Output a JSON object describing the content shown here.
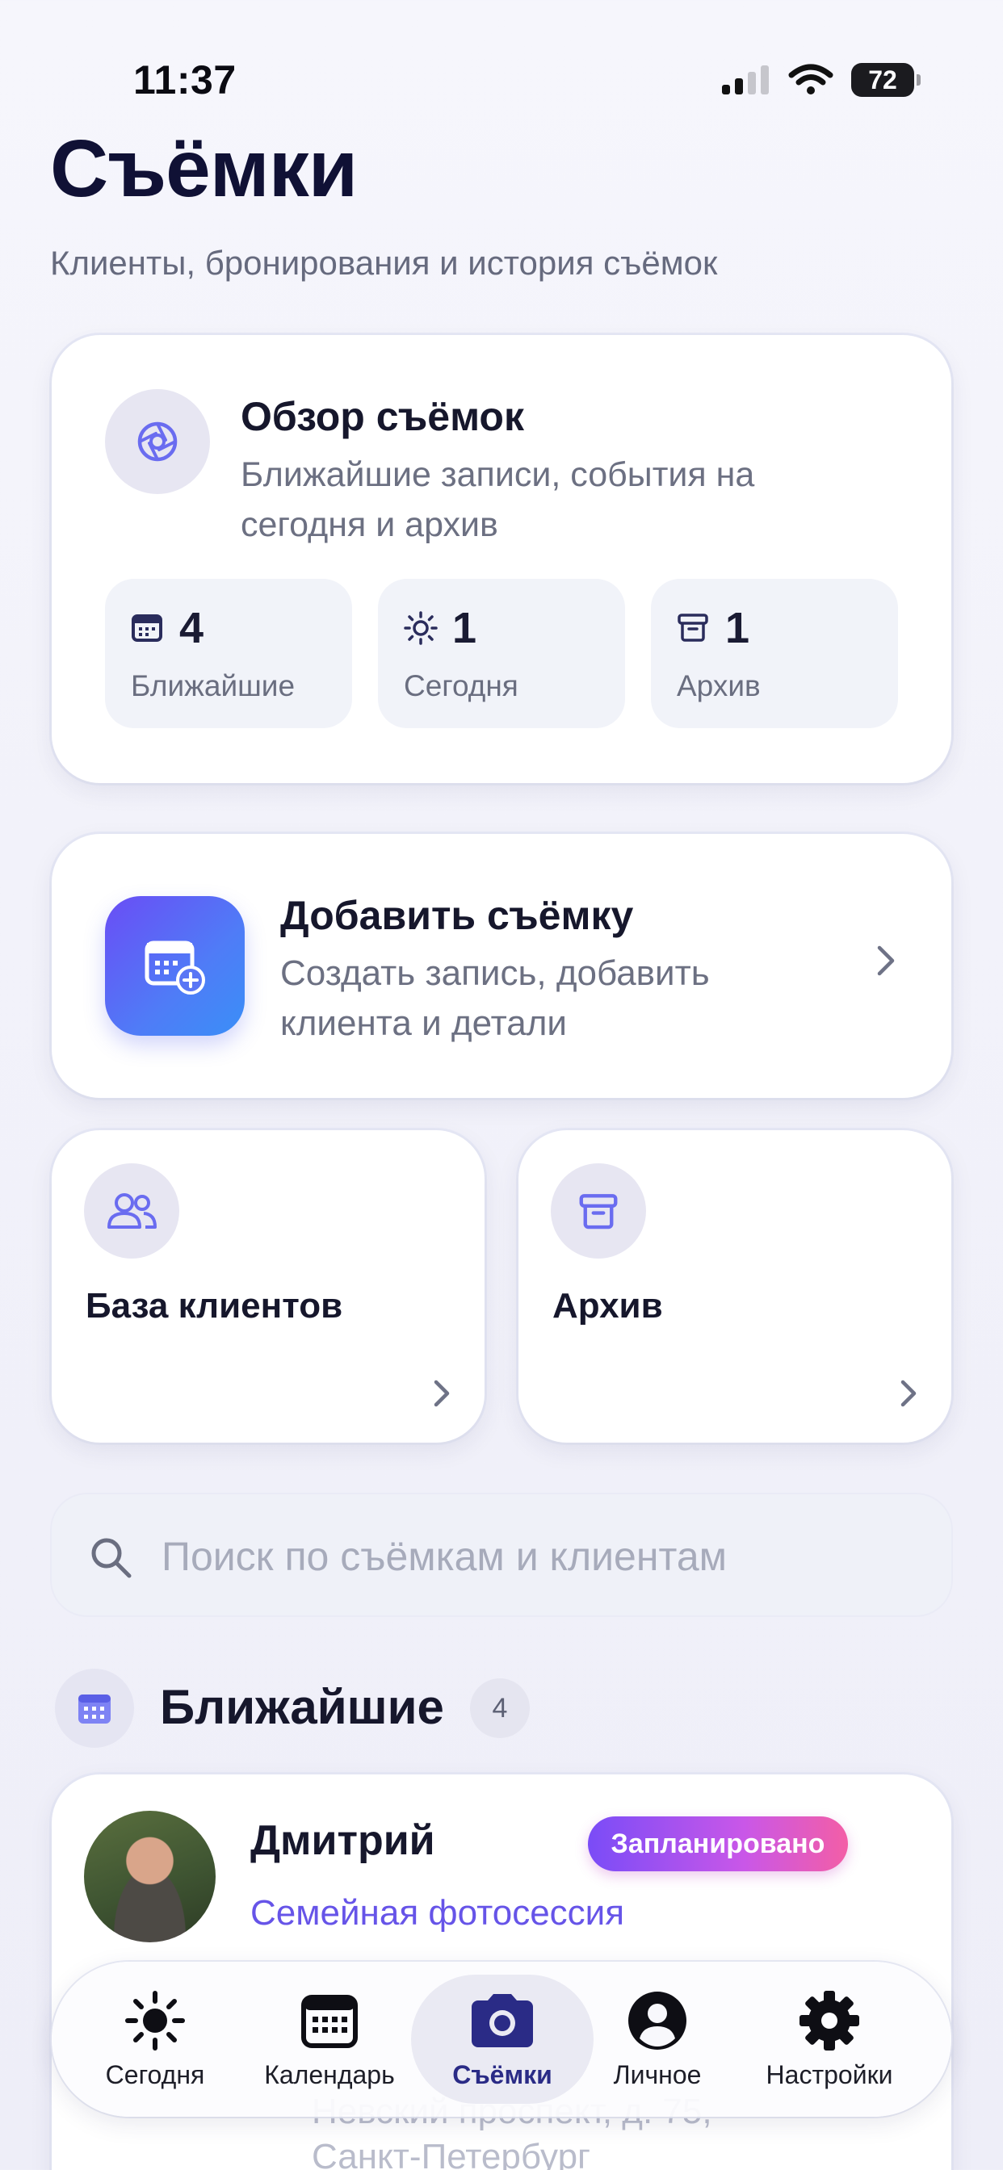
{
  "status_bar": {
    "time": "11:37",
    "battery": "72"
  },
  "header": {
    "title": "Съёмки",
    "subtitle": "Клиенты, бронирования и история съёмок"
  },
  "overview": {
    "title": "Обзор съёмок",
    "description": "Ближайшие записи, события на сегодня и архив",
    "stats": [
      {
        "icon": "calendar-icon",
        "value": "4",
        "label": "Ближайшие"
      },
      {
        "icon": "sun-icon",
        "value": "1",
        "label": "Сегодня"
      },
      {
        "icon": "archive-icon",
        "value": "1",
        "label": "Архив"
      }
    ]
  },
  "add_shoot": {
    "title": "Добавить съёмку",
    "description": "Создать запись, добавить клиента и детали"
  },
  "tiles": {
    "clients": "База клиентов",
    "archive": "Архив"
  },
  "search": {
    "placeholder": "Поиск по съёмкам и клиентам"
  },
  "upcoming": {
    "title": "Ближайшие",
    "count": "4",
    "items": [
      {
        "client": "Дмитрий",
        "status": "Запланировано",
        "type": "Семейная фотосессия",
        "address_line1": "Невский проспект, д. 75,",
        "address_line2": "Санкт-Петербург"
      }
    ]
  },
  "nav": {
    "items": [
      {
        "label": "Сегодня",
        "icon": "sun-icon"
      },
      {
        "label": "Календарь",
        "icon": "calendar-icon"
      },
      {
        "label": "Съёмки",
        "icon": "camera-icon",
        "active": true
      },
      {
        "label": "Личное",
        "icon": "person-icon"
      },
      {
        "label": "Настройки",
        "icon": "gear-icon"
      }
    ]
  },
  "colors": {
    "accent": "#6654e8",
    "title": "#101135",
    "pill_gradient_start": "#7a4cf7",
    "pill_gradient_end": "#f35ea6"
  }
}
